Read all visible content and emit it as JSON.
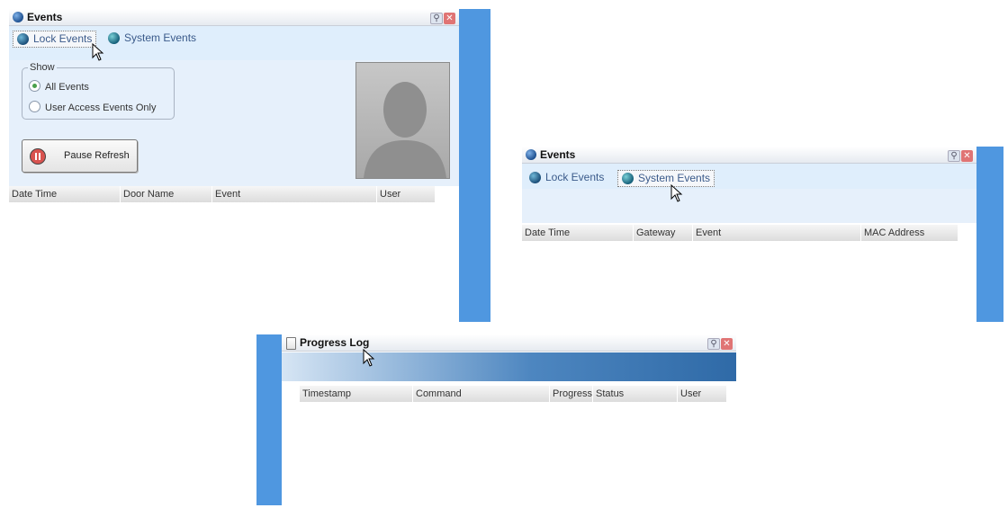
{
  "events_window_1": {
    "title": "Events",
    "tabs": [
      {
        "label": "Lock Events",
        "selected": true
      },
      {
        "label": "System Events",
        "selected": false
      }
    ],
    "show_group": {
      "legend": "Show",
      "options": [
        {
          "label": "All Events",
          "checked": true
        },
        {
          "label": "User Access Events Only",
          "checked": false
        }
      ]
    },
    "pause_button": {
      "label": "Pause Refresh"
    },
    "columns": [
      "Date Time",
      "Door Name",
      "Event",
      "User"
    ]
  },
  "events_window_2": {
    "title": "Events",
    "tabs": [
      {
        "label": "Lock Events",
        "selected": false
      },
      {
        "label": "System Events",
        "selected": true
      }
    ],
    "columns": [
      "Date Time",
      "Gateway",
      "Event",
      "MAC Address"
    ]
  },
  "progress_log_window": {
    "title": "Progress Log",
    "columns": [
      "Timestamp",
      "Command",
      "Progress",
      "Status",
      "User"
    ]
  },
  "icons": {
    "window_pin": "pin-icon",
    "window_close": "close-icon",
    "events_title": "globe-icon",
    "progress_title": "document-icon",
    "pause": "pause-icon",
    "user_photo": "user-silhouette-icon"
  },
  "colors": {
    "side_bar_blue": "#4f97e0",
    "tab_strip": "#dfeefc",
    "panel": "#e6f0fb",
    "pause_red": "#d9534f"
  }
}
